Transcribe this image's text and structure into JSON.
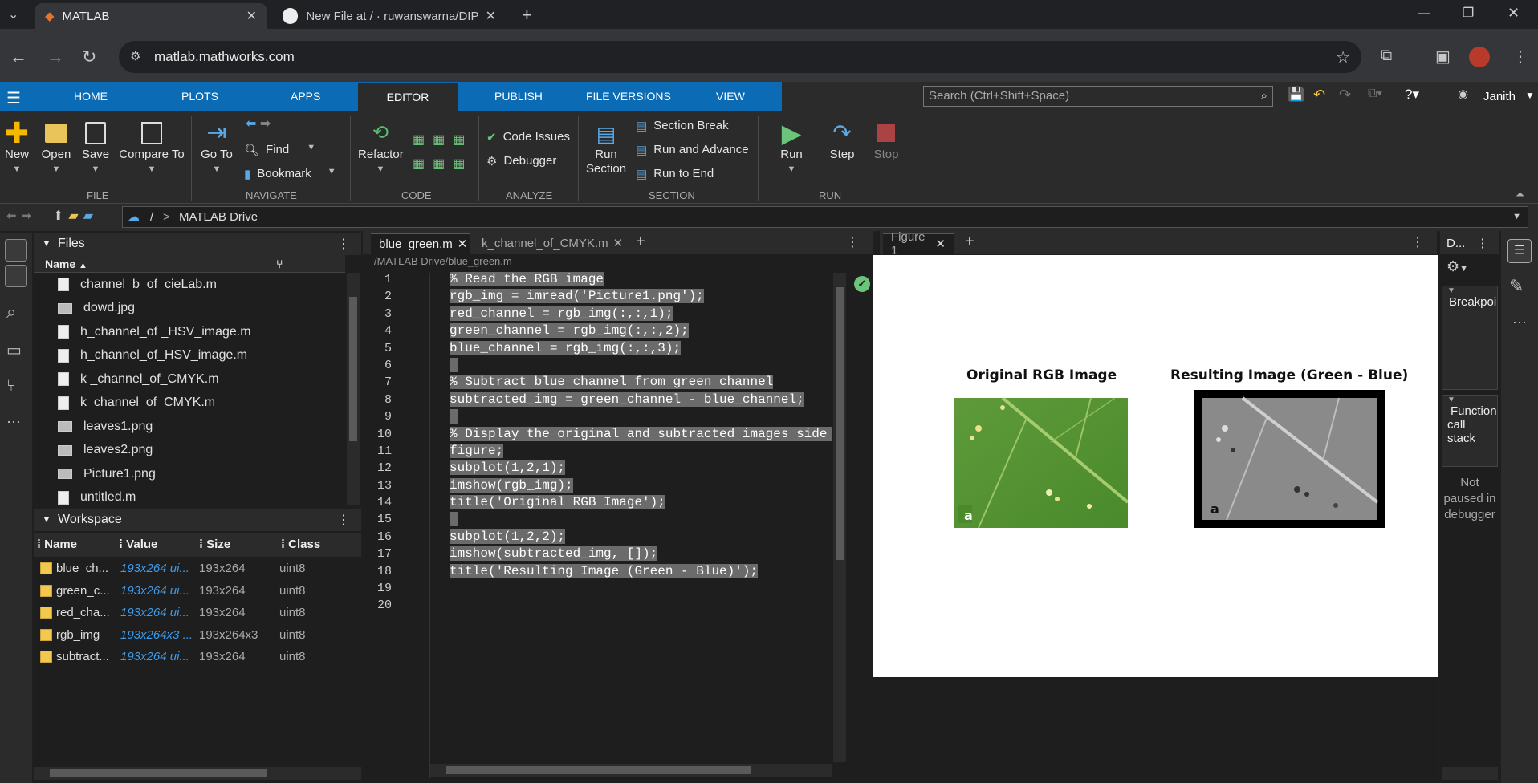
{
  "browser": {
    "tabs": [
      {
        "title": "MATLAB",
        "icon": "matlab-icon",
        "active": true
      },
      {
        "title": "New File at / · ruwanswarna/DIP",
        "icon": "github-icon",
        "active": false
      }
    ],
    "url": "matlab.mathworks.com"
  },
  "matlab": {
    "tabs": [
      "HOME",
      "PLOTS",
      "APPS",
      "EDITOR",
      "PUBLISH",
      "FILE VERSIONS",
      "VIEW"
    ],
    "search_placeholder": "Search (Ctrl+Shift+Space)",
    "user": "Janith",
    "toolstrip": {
      "file": {
        "label": "FILE",
        "new": "New",
        "open": "Open",
        "save": "Save",
        "compare": "Compare To"
      },
      "navigate": {
        "label": "NAVIGATE",
        "goto": "Go To",
        "find": "Find",
        "bookmark": "Bookmark"
      },
      "code": {
        "label": "CODE",
        "refactor": "Refactor"
      },
      "analyze": {
        "label": "ANALYZE",
        "code_issues": "Code Issues",
        "debugger": "Debugger"
      },
      "section": {
        "label": "SECTION",
        "run_section": "Run Section",
        "section_break": "Section Break",
        "run_advance": "Run and Advance",
        "run_end": "Run to End"
      },
      "run": {
        "label": "RUN",
        "run": "Run",
        "step": "Step",
        "stop": "Stop"
      }
    },
    "path": {
      "sep": "/",
      "arrow": ">",
      "current": "MATLAB Drive"
    }
  },
  "files": {
    "title": "Files",
    "column": "Name",
    "items": [
      {
        "name": "channel_b_of_cieLab.m",
        "type": "m"
      },
      {
        "name": "dowd.jpg",
        "type": "img"
      },
      {
        "name": "h_channel_of _HSV_image.m",
        "type": "m"
      },
      {
        "name": "h_channel_of_HSV_image.m",
        "type": "m"
      },
      {
        "name": "k _channel_of_CMYK.m",
        "type": "m"
      },
      {
        "name": "k_channel_of_CMYK.m",
        "type": "m"
      },
      {
        "name": "leaves1.png",
        "type": "img"
      },
      {
        "name": "leaves2.png",
        "type": "img"
      },
      {
        "name": "Picture1.png",
        "type": "img"
      },
      {
        "name": "untitled.m",
        "type": "m"
      }
    ]
  },
  "workspace": {
    "title": "Workspace",
    "columns": [
      "Name",
      "Value",
      "Size",
      "Class"
    ],
    "rows": [
      [
        "blue_ch...",
        "193x264 ui...",
        "193x264",
        "uint8"
      ],
      [
        "green_c...",
        "193x264 ui...",
        "193x264",
        "uint8"
      ],
      [
        "red_cha...",
        "193x264 ui...",
        "193x264",
        "uint8"
      ],
      [
        "rgb_img",
        "193x264x3 ...",
        "193x264x3",
        "uint8"
      ],
      [
        "subtract...",
        "193x264 ui...",
        "193x264",
        "uint8"
      ]
    ]
  },
  "editor": {
    "tabs": [
      "blue_green.m",
      "k_channel_of_CMYK.m"
    ],
    "path": "/MATLAB Drive/blue_green.m",
    "lines": [
      "% Read the RGB image",
      "rgb_img = imread('Picture1.png');",
      "red_channel = rgb_img(:,:,1);",
      "green_channel = rgb_img(:,:,2);",
      "blue_channel = rgb_img(:,:,3);",
      "",
      "% Subtract blue channel from green channel",
      "subtracted_img = green_channel - blue_channel;",
      "",
      "% Display the original and subtracted images side by",
      "figure;",
      "subplot(1,2,1);",
      "imshow(rgb_img);",
      "title('Original RGB Image');",
      "",
      "subplot(1,2,2);",
      "imshow(subtracted_img, []);",
      "title('Resulting Image (Green - Blue)');",
      "",
      ""
    ]
  },
  "figure": {
    "tab": "Figure 1",
    "left_title": "Original RGB Image",
    "right_title": "Resulting Image (Green - Blue)",
    "panel_letter": "a"
  },
  "debug": {
    "title": "D...",
    "breakpoints": "Breakpoi",
    "callstack": [
      "Function",
      "call",
      "stack"
    ],
    "status": [
      "Not",
      "paused in",
      "debugger"
    ]
  }
}
